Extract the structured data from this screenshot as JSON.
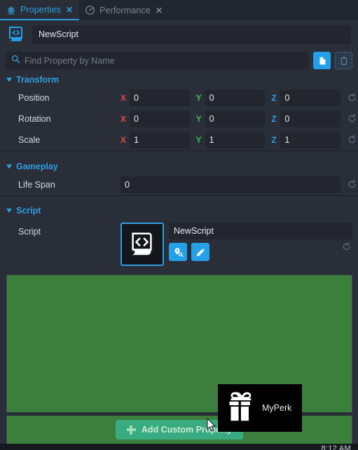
{
  "tabs": [
    {
      "label": "Properties",
      "icon": "gear-icon",
      "close": "✕",
      "active": true
    },
    {
      "label": "Performance",
      "icon": "gauge-icon",
      "close": "✕",
      "active": false
    }
  ],
  "object": {
    "icon": "script-file-icon",
    "name": "NewScript"
  },
  "search": {
    "placeholder": "Find Property by Name",
    "icon": "search-icon",
    "copy_icon": "copy-document-icon",
    "paste_icon": "paste-clipboard-icon"
  },
  "sections": [
    {
      "id": "transform",
      "title": "Transform",
      "rows": [
        {
          "label": "Position",
          "axes": [
            {
              "axis": "X",
              "value": "0"
            },
            {
              "axis": "Y",
              "value": "0"
            },
            {
              "axis": "Z",
              "value": "0"
            }
          ]
        },
        {
          "label": "Rotation",
          "axes": [
            {
              "axis": "X",
              "value": "0"
            },
            {
              "axis": "Y",
              "value": "0"
            },
            {
              "axis": "Z",
              "value": "0"
            }
          ]
        },
        {
          "label": "Scale",
          "axes": [
            {
              "axis": "X",
              "value": "1"
            },
            {
              "axis": "Y",
              "value": "1"
            },
            {
              "axis": "Z",
              "value": "1"
            }
          ]
        }
      ]
    },
    {
      "id": "gameplay",
      "title": "Gameplay",
      "rows": [
        {
          "label": "Life Span",
          "value": "0"
        }
      ]
    },
    {
      "id": "script",
      "title": "Script",
      "rows": [
        {
          "label": "Script",
          "value": "NewScript"
        }
      ]
    }
  ],
  "script_row": {
    "label": "Script",
    "thumb_icon": "script-scroll-icon",
    "name_value": "NewScript",
    "locate_icon": "locate-pin-icon",
    "edit_icon": "pencil-edit-icon",
    "reset_icon": "reset-arrow-icon"
  },
  "add_button": {
    "label": "Add Custom Property",
    "icon": "plus-icon"
  },
  "tooltip": {
    "label": "MyPerk",
    "icon": "gift-box-icon"
  },
  "statusbar": {
    "clock": "8:12 AM"
  },
  "colors": {
    "accent": "#2f9ede",
    "panel_bg": "#2a2e39",
    "field_bg": "#23262f",
    "axis_x": "#e2483f",
    "axis_y": "#34c24a",
    "axis_z": "#2f9ede",
    "green_overlay": "#3c7f3c",
    "add_button": "#38ac80",
    "tooltip_bg": "#000000"
  }
}
